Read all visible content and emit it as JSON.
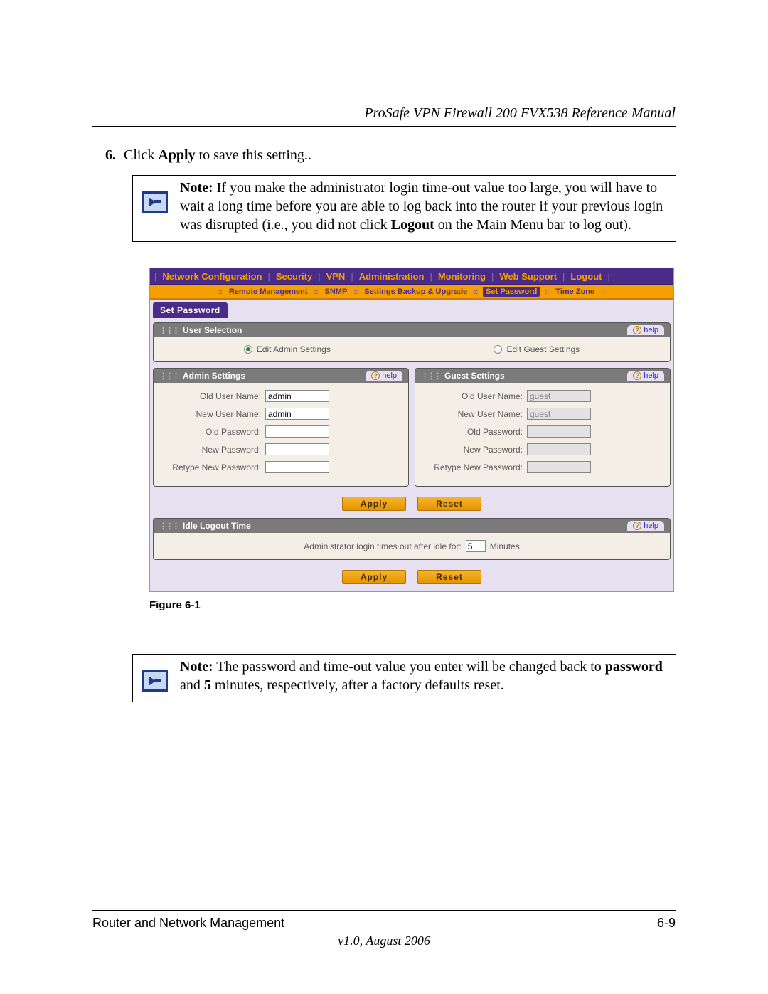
{
  "header": {
    "manual_title": "ProSafe VPN Firewall 200 FVX538 Reference Manual"
  },
  "step": {
    "number": "6.",
    "pre": "Click ",
    "bold": "Apply",
    "post": " to save this setting.."
  },
  "note1": {
    "bold": "Note:",
    "text1": " If you make the administrator login time-out value too large, you will have to wait a long time before you are able to log back into the router if your previous login was disrupted (i.e., you did not click ",
    "bold2": "Logout",
    "text2": " on the Main Menu bar to log out)."
  },
  "ui": {
    "main_nav": [
      "Network Configuration",
      "Security",
      "VPN",
      "Administration",
      "Monitoring",
      "Web Support",
      "Logout"
    ],
    "sub_nav": [
      "Remote Management",
      "SNMP",
      "Settings Backup & Upgrade",
      "Set Password",
      "Time Zone"
    ],
    "sub_nav_active": 3,
    "tab": "Set Password",
    "help": "help",
    "panels": {
      "user_selection": {
        "title": "User Selection",
        "opt_admin": "Edit Admin Settings",
        "opt_guest": "Edit Guest Settings",
        "selected": "admin"
      },
      "admin": {
        "title": "Admin Settings",
        "fields": {
          "old_user": {
            "label": "Old User Name:",
            "value": "admin"
          },
          "new_user": {
            "label": "New User Name:",
            "value": "admin"
          },
          "old_pw": {
            "label": "Old Password:",
            "value": ""
          },
          "new_pw": {
            "label": "New Password:",
            "value": ""
          },
          "retype": {
            "label": "Retype New Password:",
            "value": ""
          }
        }
      },
      "guest": {
        "title": "Guest Settings",
        "fields": {
          "old_user": {
            "label": "Old User Name:",
            "value": "guest"
          },
          "new_user": {
            "label": "New User Name:",
            "value": "guest"
          },
          "old_pw": {
            "label": "Old Password:",
            "value": ""
          },
          "new_pw": {
            "label": "New Password:",
            "value": ""
          },
          "retype": {
            "label": "Retype New Password:",
            "value": ""
          }
        }
      },
      "idle": {
        "title": "Idle Logout Time",
        "label_pre": "Administrator login times out after idle for:",
        "value": "5",
        "label_post": "Minutes"
      }
    },
    "buttons": {
      "apply": "Apply",
      "reset": "Reset"
    }
  },
  "figure_caption": "Figure 6-1",
  "note2": {
    "bold": "Note:",
    "text1": " The password and time-out value you enter will be changed back to ",
    "bold2": "password",
    "text2": " and ",
    "bold3": "5",
    "text3": " minutes, respectively, after a factory defaults reset."
  },
  "footer": {
    "section": "Router and Network Management",
    "page": "6-9",
    "version": "v1.0, August 2006"
  }
}
